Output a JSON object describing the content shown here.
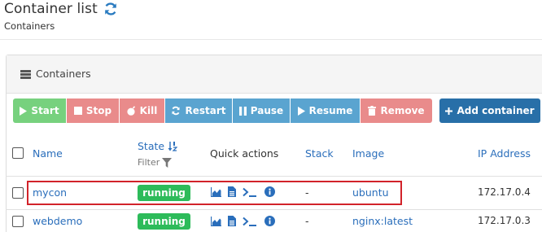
{
  "header": {
    "title": "Container list",
    "breadcrumb": "Containers"
  },
  "widget": {
    "title": "Containers"
  },
  "toolbar": {
    "start": "Start",
    "stop": "Stop",
    "kill": "Kill",
    "restart": "Restart",
    "pause": "Pause",
    "resume": "Resume",
    "remove": "Remove",
    "add": "Add container"
  },
  "table": {
    "columns": {
      "name": "Name",
      "state": "State",
      "state_filter": "Filter",
      "quick_actions": "Quick actions",
      "stack": "Stack",
      "image": "Image",
      "ip": "IP Address"
    },
    "rows": [
      {
        "name": "mycon",
        "state": "running",
        "stack": "-",
        "image": "ubuntu",
        "ip": "172.17.0.4"
      },
      {
        "name": "webdemo",
        "state": "running",
        "stack": "-",
        "image": "nginx:latest",
        "ip": "172.17.0.3"
      }
    ]
  },
  "colors": {
    "start": "#77d17e",
    "danger": "#e98b8b",
    "info": "#5aa4d0",
    "primary": "#286fa8",
    "running": "#2dbb5a",
    "highlight": "#d2232a",
    "link": "#2a6ebb"
  },
  "icons": [
    "refresh-icon",
    "list-icon",
    "play-icon",
    "stop-icon",
    "bomb-icon",
    "refresh-icon",
    "pause-icon",
    "play-icon",
    "trash-icon",
    "plus-icon",
    "sort-icon",
    "filter-icon",
    "stats-icon",
    "logs-icon",
    "console-icon",
    "info-icon"
  ]
}
